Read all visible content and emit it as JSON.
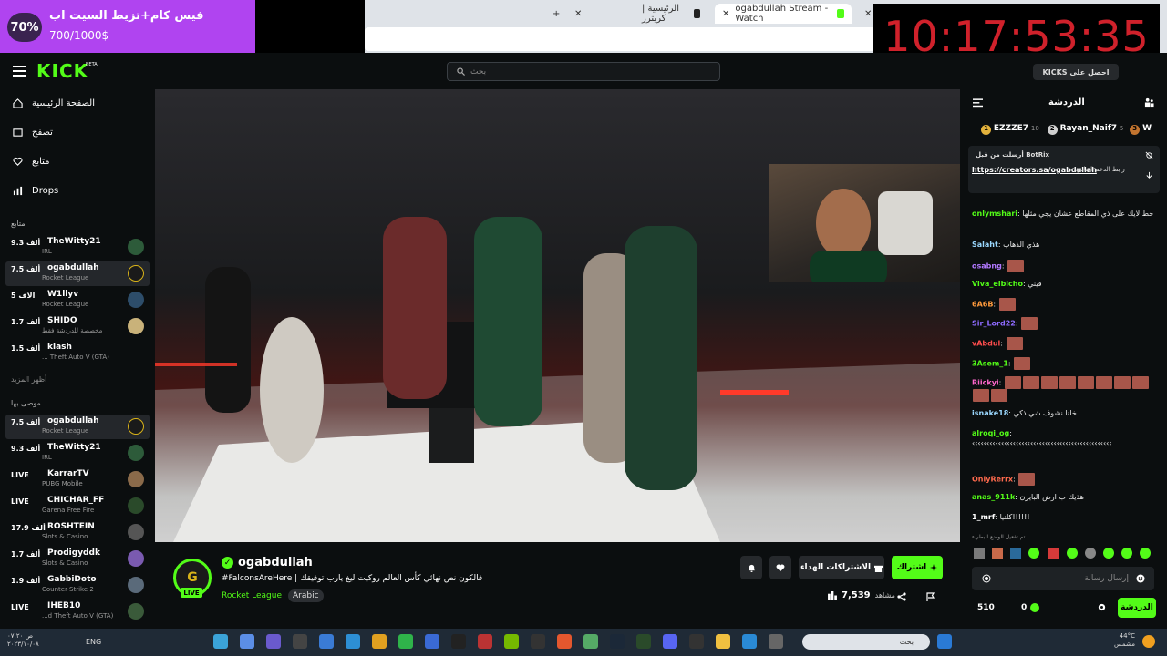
{
  "browser": {
    "tabs": [
      {
        "label": "الرئيسية | كريترز",
        "active": false
      },
      {
        "label": "ogabdullah Stream - Watch",
        "active": true
      }
    ],
    "new_tab": "+",
    "close": "✕"
  },
  "goal_widget": {
    "percent_label": "70%",
    "percent_value": 70,
    "title": "فيس كام+تزيط السيت اب",
    "progress": "700/1000$",
    "accent_color": "#b044f0"
  },
  "clock": "10:17:53:35",
  "header": {
    "logo": "KICK",
    "logo_tag": "BETA",
    "search_placeholder": "بحث",
    "kicks_button": "KICKS احصل على"
  },
  "sidebar": {
    "nav": [
      {
        "label": "الصفحة الرئيسية",
        "icon": "home-icon"
      },
      {
        "label": "تصفح",
        "icon": "browse-icon"
      },
      {
        "label": "متابع",
        "icon": "heart-icon"
      },
      {
        "label": "Drops",
        "icon": "drops-icon"
      }
    ],
    "following_label": "متابع",
    "following": [
      {
        "viewers": "9.3 ألف",
        "name": "TheWitty21",
        "category": "IRL",
        "active": false
      },
      {
        "viewers": "7.5 ألف",
        "name": "ogabdullah",
        "category": "Rocket League",
        "active": true
      },
      {
        "viewers": "5 الآف",
        "name": "W1llyv",
        "category": "Rocket League",
        "active": false
      },
      {
        "viewers": "1.7 ألف",
        "name": "SHIDO",
        "category": "مخصصة للدردشة فقط",
        "active": false
      },
      {
        "viewers": "1.5 ألف",
        "name": "klash",
        "category": "... Theft Auto V (GTA)",
        "active": false
      }
    ],
    "show_more": "أظهر المزيد",
    "recommended_label": "موصى بها",
    "recommended": [
      {
        "viewers": "7.5 ألف",
        "name": "ogabdullah",
        "category": "Rocket League",
        "active": true
      },
      {
        "viewers": "9.3 ألف",
        "name": "TheWitty21",
        "category": "IRL",
        "active": false
      },
      {
        "viewers": "LIVE",
        "name": "KarrarTV",
        "category": "PUBG Mobile",
        "active": false
      },
      {
        "viewers": "LIVE",
        "name": "CHICHAR_FF",
        "category": "Garena Free Fire",
        "active": false
      },
      {
        "viewers": "17.9 ألف",
        "name": "ROSHTEIN",
        "category": "Slots & Casino",
        "active": false
      },
      {
        "viewers": "1.7 ألف",
        "name": "Prodigyddk",
        "category": "Slots & Casino",
        "active": false
      },
      {
        "viewers": "1.9 ألف",
        "name": "GabbiDoto",
        "category": "Counter-Strike 2",
        "active": false
      },
      {
        "viewers": "LIVE",
        "name": "IHEB10",
        "category": "...d Theft Auto V (GTA)",
        "active": false
      }
    ]
  },
  "stream": {
    "streamer": "ogabdullah",
    "avatar_letter": "G",
    "live_label": "LIVE",
    "title": "#FalconsAreHere | فالكون نص نهائي كأس العالم روكيت ليغ يارب توفيقك",
    "category": "Rocket League",
    "language": "Arabic",
    "subscribe_button": "اشتراك",
    "gift_button": "الاشتراكات الهداء",
    "viewers": "7,539",
    "viewers_label": "مشاهد"
  },
  "chat": {
    "title": "الدردشة",
    "leaderboard": [
      {
        "rank": "1",
        "name": "EZZZE7",
        "score": "10"
      },
      {
        "rank": "2",
        "name": "Rayan_Naif7",
        "score": "5"
      },
      {
        "rank": "3",
        "name": "W",
        "score": ""
      }
    ],
    "pinned": {
      "by": "أرسلت من قبل BotRix",
      "link": "https://creators.sa/ogabdullah",
      "text": "رابط الدعم المادي"
    },
    "messages": [
      {
        "user": "onlymshari",
        "text": "حط لايك على ذي المقاطع عشان يجي مثلها",
        "color": "#53fc18"
      },
      {
        "user": "Salaht",
        "text": "هذي الذهاب",
        "color": "#9bd8ff"
      },
      {
        "user": "osabng",
        "text": "",
        "color": "#b278ff",
        "emotes": 1
      },
      {
        "user": "Viva_elbicho",
        "text": "فيني",
        "color": "#53fc18"
      },
      {
        "user": "6A6B",
        "text": "",
        "color": "#ff9a3c",
        "emotes": 1
      },
      {
        "user": "Sir_Lord22",
        "text": "",
        "color": "#8e6bff",
        "emotes": 1
      },
      {
        "user": "vAbdul",
        "text": "",
        "color": "#ff4d4d",
        "emotes": 1
      },
      {
        "user": "3Asem_1",
        "text": "",
        "color": "#53fc18",
        "emotes": 1
      },
      {
        "user": "Riickyi",
        "text": "",
        "color": "#ff66cc",
        "emotes": 10
      },
      {
        "user": "isnake18",
        "text": "خلنا نشوف شي ذكي",
        "color": "#9bd8ff"
      },
      {
        "user": "alroqi_og",
        "text": "‹‹‹‹‹‹‹‹‹‹‹‹‹‹‹‹‹‹‹‹‹‹‹‹‹‹‹‹‹‹‹‹‹‹‹‹‹‹‹‹‹‹‹‹‹‹‹‹",
        "color": "#53fc18"
      },
      {
        "user": "OnlyRerrx",
        "text": "",
        "color": "#ff6a4d",
        "emotes": 1
      },
      {
        "user": "anas_911k",
        "text": "هذيك ب ارض البايرن",
        "color": "#53fc18"
      },
      {
        "user": "1_mrf",
        "text": "كلنيا!!!!!!",
        "color": "#fff"
      }
    ],
    "system_note": "تم تفعيل الوضع البطيء",
    "input_placeholder": "إرسال رسالة",
    "send_button": "الدردشة",
    "kicks_balance": "0",
    "points": "510"
  },
  "taskbar": {
    "time": "۰۷:۲۰ ص",
    "date": "۲۰۲۳/۱۰/۰۸",
    "lang": "ENG",
    "search_placeholder": "بحث",
    "temp": "44°C",
    "weather": "مشمس"
  }
}
